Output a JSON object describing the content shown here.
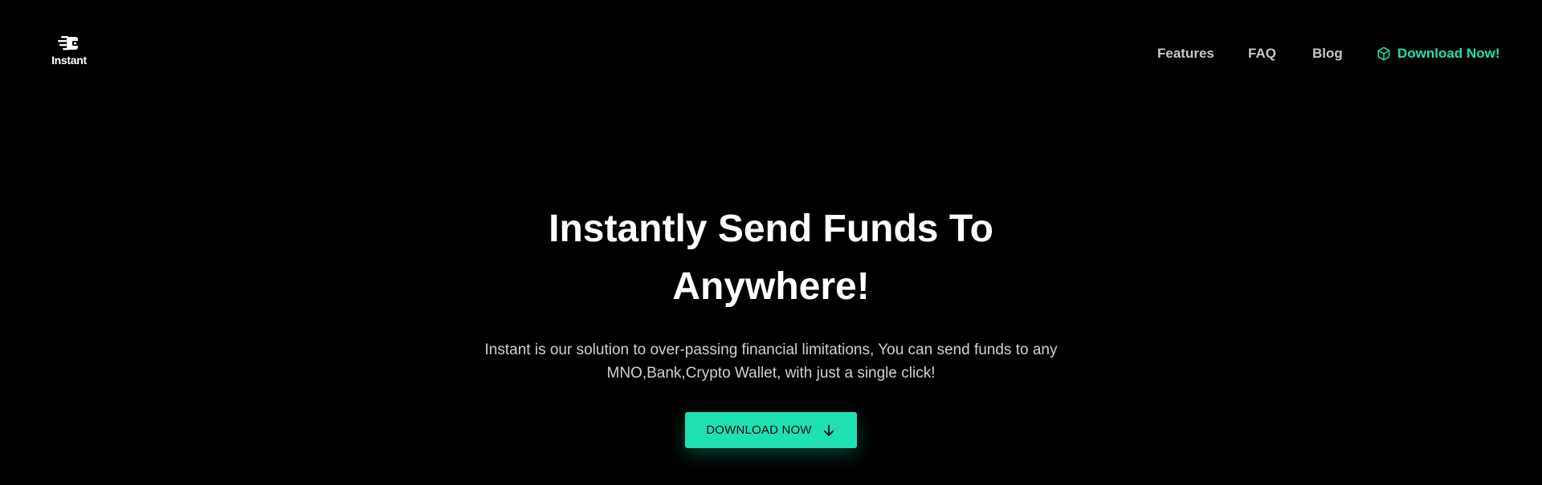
{
  "header": {
    "logo": {
      "text": "Instant",
      "icon": "wallet-send-icon"
    },
    "nav": {
      "items": [
        {
          "label": "Features"
        },
        {
          "label": "FAQ"
        },
        {
          "label": "Blog"
        }
      ],
      "download": {
        "label": "Download Now!",
        "icon": "box-icon",
        "color": "#1fe0b0"
      }
    }
  },
  "hero": {
    "title": "Instantly Send Funds To Anywhere!",
    "subtitle": "Instant is our solution to over-passing financial limitations, You can send funds to any MNO,Bank,Crypto Wallet, with just a single click!",
    "cta": {
      "label": "DOWNLOAD NOW",
      "icon": "arrow-down-icon",
      "color": "#1fe0b0"
    }
  },
  "theme": {
    "background": "#000000",
    "accent": "#1fe0b0",
    "text": "#ffffff",
    "muted_text": "#c8c8c8"
  }
}
